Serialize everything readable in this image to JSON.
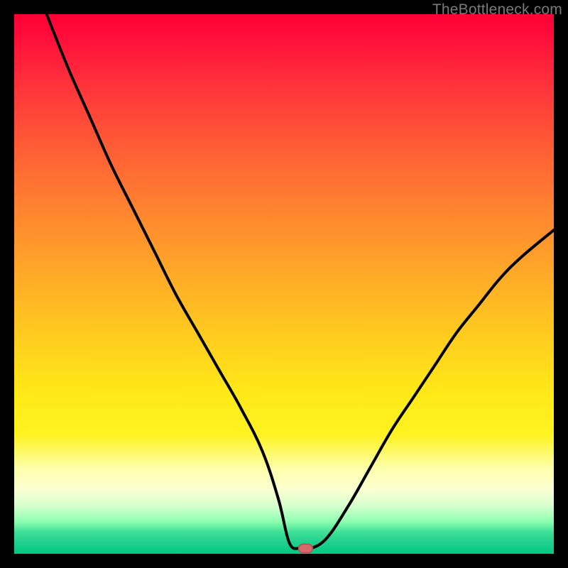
{
  "watermark": "TheBottleneck.com",
  "colors": {
    "frame": "#000000",
    "gradient_top": "#ff0033",
    "gradient_mid": "#ffe818",
    "gradient_bottom": "#00c883",
    "curve": "#000000",
    "marker_fill": "#d46a6a",
    "marker_stroke": "#b44f4f"
  },
  "chart_data": {
    "type": "line",
    "title": "",
    "xlabel": "",
    "ylabel": "",
    "xlim": [
      0,
      100
    ],
    "ylim": [
      0,
      100
    ],
    "grid": false,
    "legend_position": "none",
    "note": "y decreases from ~100 at x≈6 to ~0 near x≈51, flat near 0 until x≈55, then rises to ~60 at x=100. Marker at approximate minimum.",
    "series": [
      {
        "name": "bottleneck-curve",
        "x": [
          6,
          10,
          14,
          18,
          22,
          26,
          30,
          34,
          38,
          42,
          46,
          49,
          51,
          53,
          55,
          58,
          62,
          66,
          70,
          74,
          78,
          82,
          86,
          90,
          94,
          100
        ],
        "y": [
          100,
          90,
          81,
          72,
          64,
          56,
          48,
          41,
          34,
          27,
          19,
          10,
          2,
          1,
          1,
          3,
          9,
          16,
          23,
          29,
          35,
          41,
          46,
          51,
          55,
          60
        ]
      }
    ],
    "marker": {
      "x": 54,
      "y": 1
    }
  }
}
